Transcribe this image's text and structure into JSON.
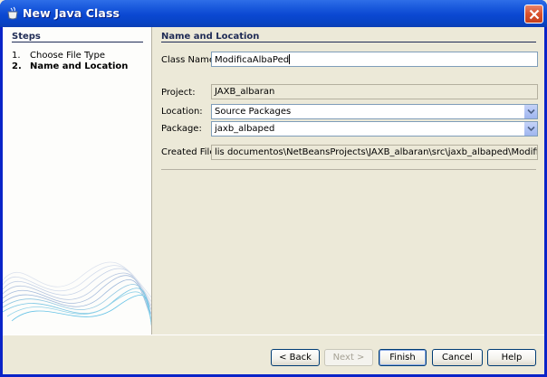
{
  "window": {
    "title": "New Java Class"
  },
  "steps": {
    "title": "Steps",
    "items": [
      {
        "num": "1.",
        "label": "Choose File Type"
      },
      {
        "num": "2.",
        "label": "Name and Location"
      }
    ]
  },
  "panel": {
    "title": "Name and Location",
    "class_name_label": "Class Name:",
    "class_name_value": "ModificaAlbaPed",
    "project_label": "Project:",
    "project_value": "JAXB_albaran",
    "location_label": "Location:",
    "location_value": "Source Packages",
    "package_label": "Package:",
    "package_value": "jaxb_albaped",
    "created_file_label": "Created File:",
    "created_file_value": "lis documentos\\NetBeansProjects\\JAXB_albaran\\src\\jaxb_albaped\\ModificaAlbaPed.java"
  },
  "buttons": {
    "back": "< Back",
    "next": "Next >",
    "finish": "Finish",
    "cancel": "Cancel",
    "help": "Help"
  },
  "colors": {
    "title_bar": "#0b48d2",
    "heading": "#1f2b55",
    "dialog_bg": "#ece9d8"
  }
}
